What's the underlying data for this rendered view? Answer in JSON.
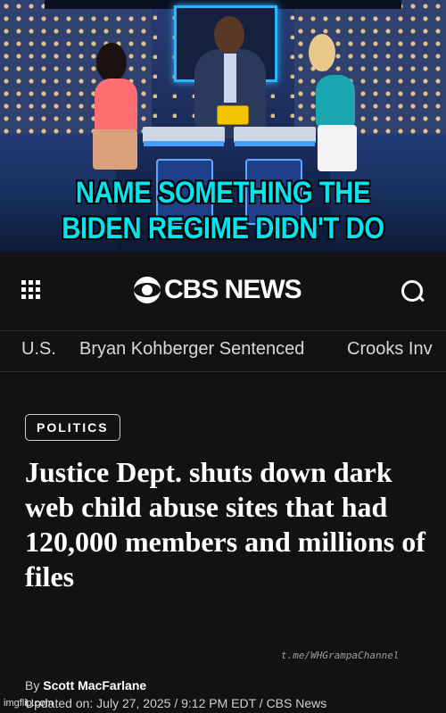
{
  "meme": {
    "caption_line1": "NAME SOMETHING THE",
    "caption_line2": "BIDEN REGIME DIDN'T DO",
    "caption_color": "#00e6f0"
  },
  "cbs": {
    "logo_text": "CBS NEWS",
    "nav": [
      "U.S.",
      "Bryan Kohberger Sentenced",
      "Crooks Inv"
    ],
    "tag": "POLITICS",
    "headline": "Justice Dept. shuts down dark web child abuse sites that had 120,000 members and millions of files",
    "watermark": "t.me/WHGrampaChannel",
    "byline_prefix": "By",
    "author": "Scott MacFarlane",
    "updated": "Updated on: July 27, 2025 / 9:12 PM EDT / CBS News"
  },
  "footer": {
    "imgflip": "imgflip.com"
  },
  "icons": [
    "menu-grid-icon",
    "cbs-eye-icon",
    "search-icon"
  ]
}
